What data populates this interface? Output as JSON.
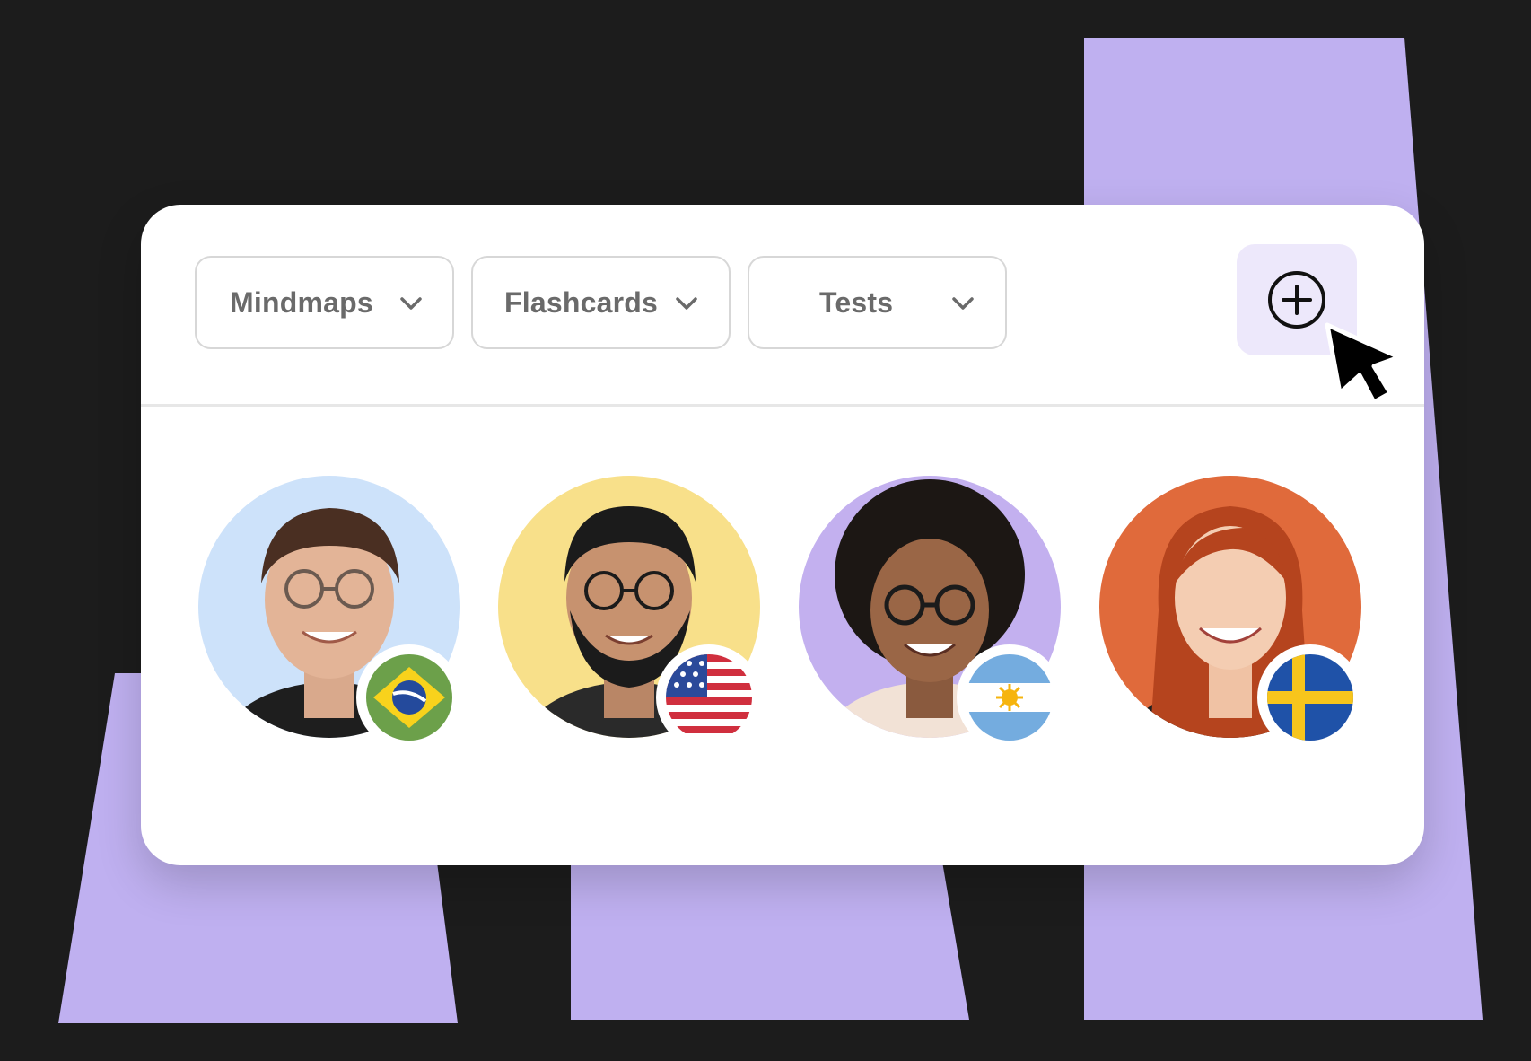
{
  "colors": {
    "page_background": "#1c1c1c",
    "accent_shape": "#bfb0f0",
    "card_background": "#ffffff",
    "dropdown_text": "#6a6a6a",
    "dropdown_border": "#d7d7d7",
    "add_button_background": "#ede8fb"
  },
  "toolbar": {
    "dropdowns": [
      {
        "label": "Mindmaps",
        "icon": "chevron-down-icon"
      },
      {
        "label": "Flashcards",
        "icon": "chevron-down-icon"
      },
      {
        "label": "Tests",
        "icon": "chevron-down-icon"
      }
    ],
    "add_button": {
      "icon": "plus-circle-icon"
    },
    "cursor": {
      "icon": "mouse-pointer-icon"
    }
  },
  "people": [
    {
      "avatar_bg": "#cde2fa",
      "flag": "brazil-flag-icon"
    },
    {
      "avatar_bg": "#f8e08a",
      "flag": "usa-flag-icon"
    },
    {
      "avatar_bg": "#c3b0ef",
      "flag": "argentina-flag-icon"
    },
    {
      "avatar_bg": "#e06a3b",
      "flag": "sweden-flag-icon"
    }
  ]
}
